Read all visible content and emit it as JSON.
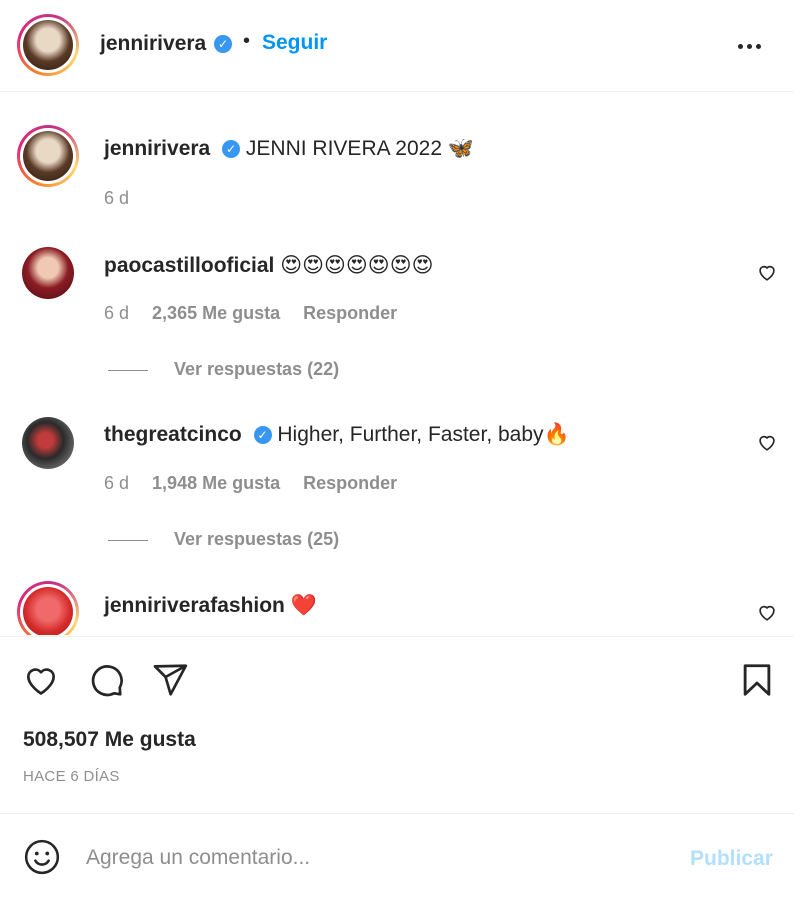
{
  "header": {
    "username": "jennirivera",
    "verified_mark": "✓",
    "separator": "•",
    "follow_label": "Seguir"
  },
  "caption": {
    "username": "jennirivera",
    "verified_mark": "✓",
    "text": "JENNI RIVERA 2022",
    "emoji": "🦋",
    "time": "6 d"
  },
  "comments": [
    {
      "username": "paocastillooficial",
      "verified": false,
      "text": "😍😍😍😍😍😍😍",
      "time": "6 d",
      "likes": "2,365 Me gusta",
      "reply_label": "Responder",
      "view_replies": "Ver respuestas (22)"
    },
    {
      "username": "thegreatcinco",
      "verified": true,
      "verified_mark": "✓",
      "text": "Higher, Further, Faster, baby🔥",
      "time": "6 d",
      "likes": "1,948 Me gusta",
      "reply_label": "Responder",
      "view_replies": "Ver respuestas (25)"
    },
    {
      "username": "jenniriverafashion",
      "verified": false,
      "text": "❤️"
    }
  ],
  "post": {
    "likes_total": "508,507 Me gusta",
    "posted_ago": "HACE 6 DÍAS"
  },
  "composer": {
    "placeholder": "Agrega un comentario...",
    "publish_label": "Publicar"
  },
  "colors": {
    "accent": "#0095f6",
    "verified": "#3897f0",
    "muted": "#8e8e8e",
    "publish_disabled": "#b2dffc"
  },
  "icons": [
    "verified-badge-icon",
    "more-options-icon",
    "heart-icon",
    "comment-icon",
    "share-icon",
    "bookmark-icon",
    "emoji-icon"
  ]
}
